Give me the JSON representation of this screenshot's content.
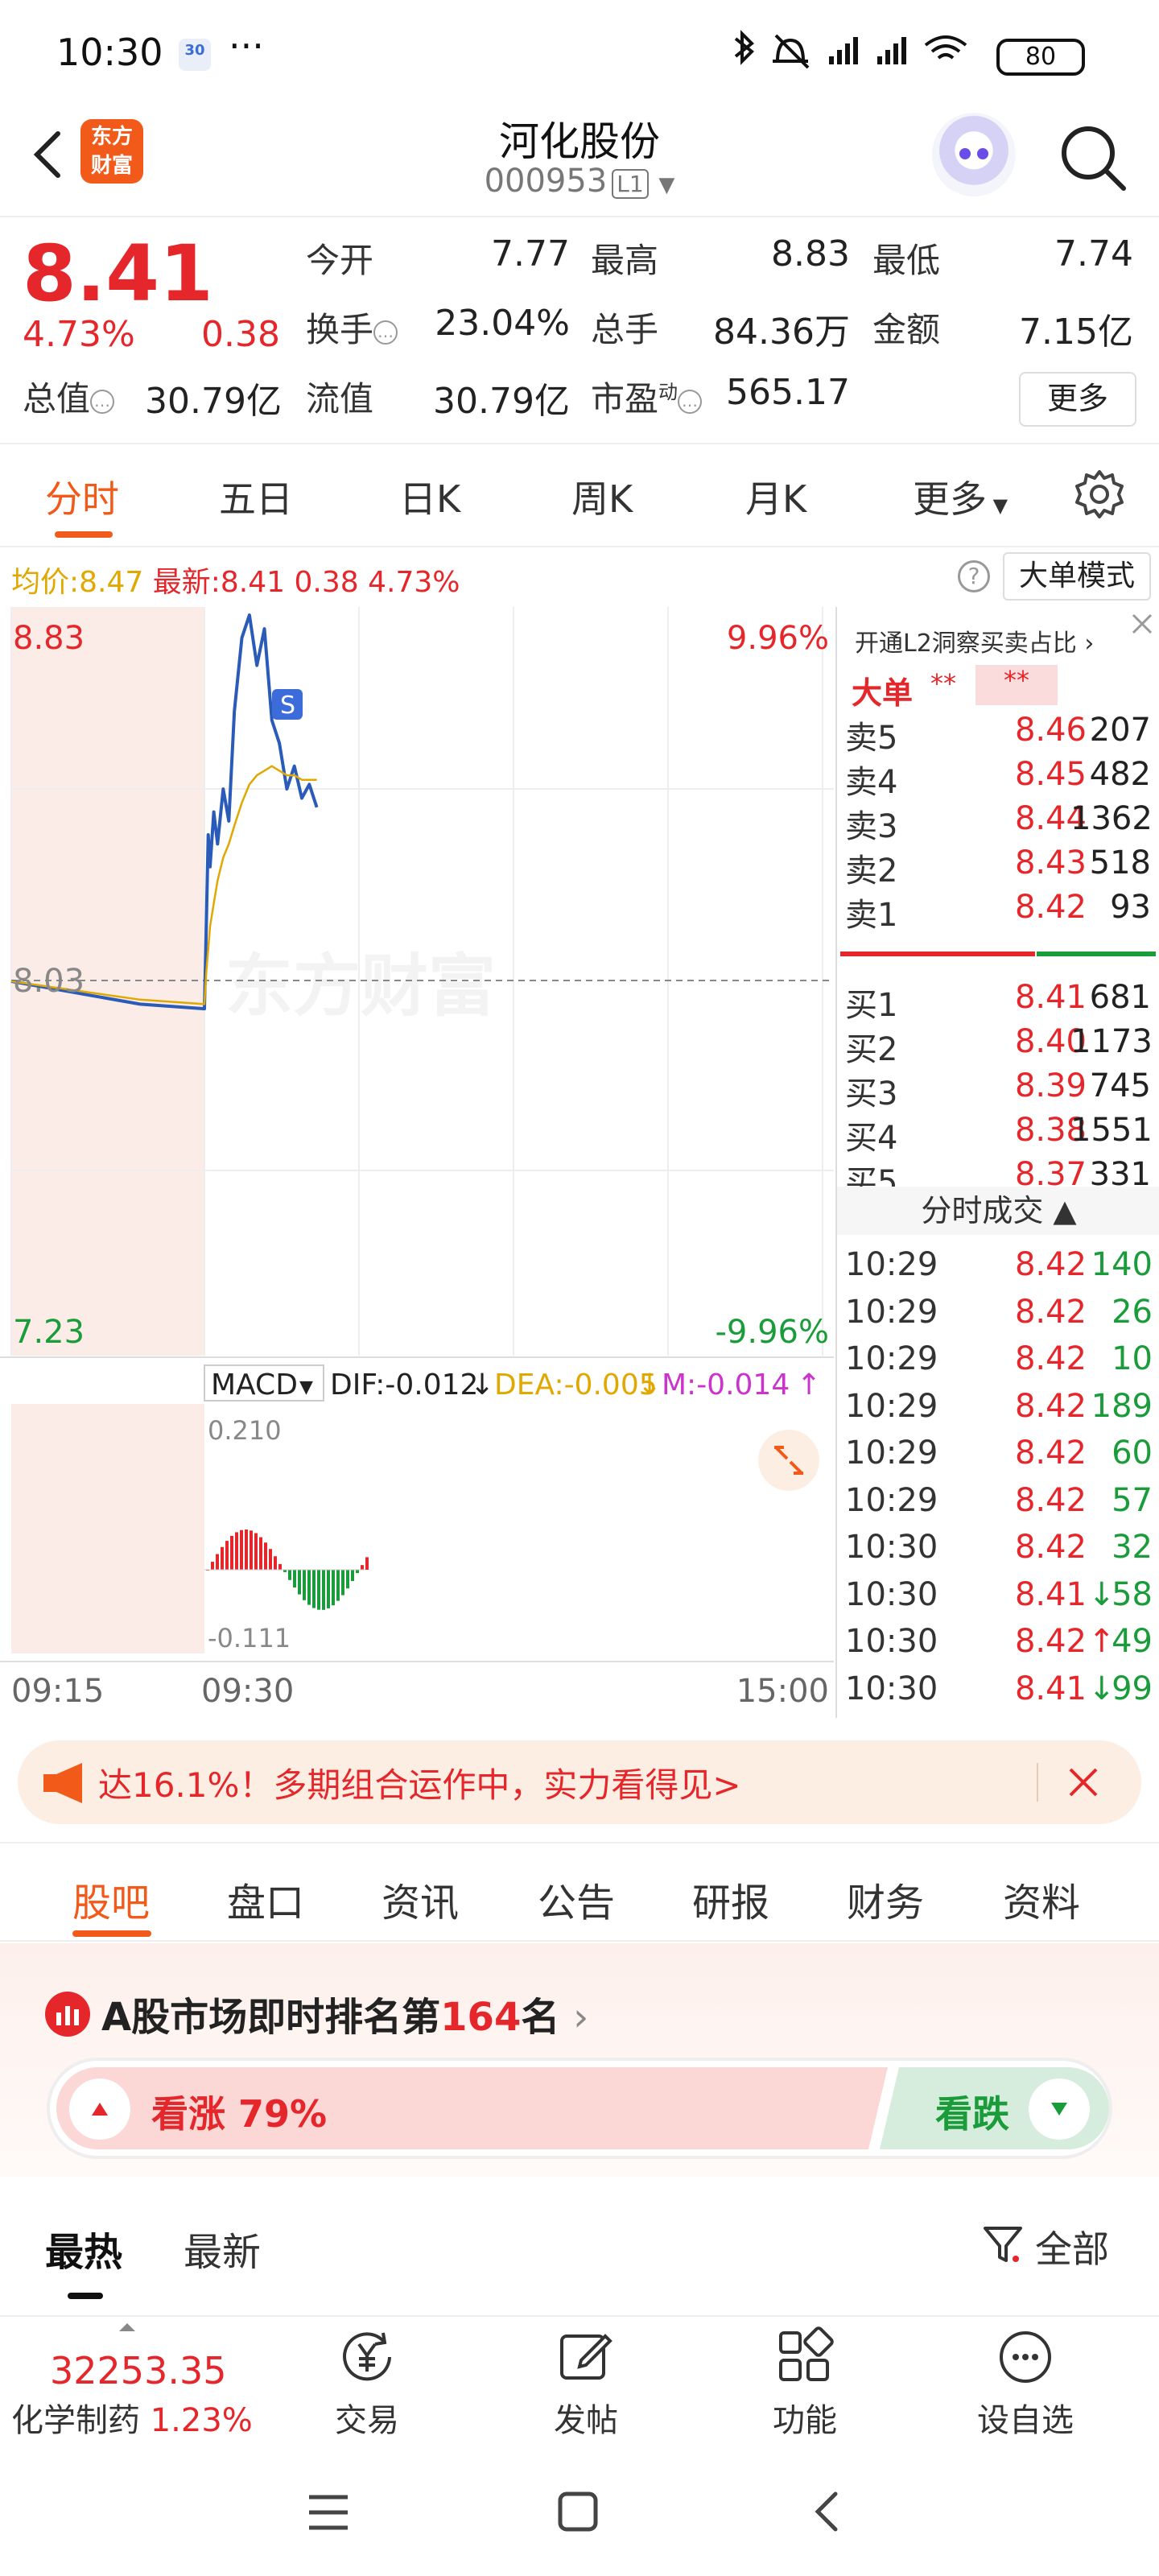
{
  "status_bar": {
    "time": "10:30",
    "indicator": "30",
    "dots": "···",
    "battery": "80",
    "icons": [
      "bluetooth-icon",
      "mute-icon",
      "signal-icon",
      "wifi-icon"
    ]
  },
  "header": {
    "title": "河化股份",
    "code": "000953",
    "level": "L1",
    "logo_line1": "东方",
    "logo_line2": "财富"
  },
  "quote": {
    "price": "8.41",
    "change_pct": "4.73%",
    "change": "0.38",
    "open_label": "今开",
    "open": "7.77",
    "high_label": "最高",
    "high": "8.83",
    "low_label": "最低",
    "low": "7.74",
    "turnover_label": "换手",
    "turnover": "23.04%",
    "volume_label": "总手",
    "volume": "84.36万",
    "amount_label": "金额",
    "amount": "7.15亿",
    "mcap_label": "总值",
    "mcap": "30.79亿",
    "float_label": "流值",
    "float": "30.79亿",
    "pe_label": "市盈",
    "pe_sup": "动",
    "pe": "565.17",
    "more": "更多"
  },
  "period_tabs": [
    "分时",
    "五日",
    "日K",
    "周K",
    "月K",
    "更多"
  ],
  "info_line": {
    "avg_label": "均价:",
    "avg": "8.47",
    "latest_label": "最新:",
    "latest": "8.41",
    "chg": "0.38",
    "pct": "4.73%",
    "mode_button": "大单模式"
  },
  "chart": {
    "price_top": "8.83",
    "price_mid": "8.03",
    "price_bottom": "7.23",
    "pct_top": "9.96%",
    "pct_bottom": "-9.96%",
    "watermark": "东方财富",
    "marker": "S",
    "macd_label": "MACD",
    "dif": "DIF:-0.012",
    "dea": "DEA:-0.005",
    "m": "M:-0.014",
    "macd_top": "0.210",
    "macd_bottom": "-0.111",
    "time_start": "09:15",
    "time_open": "09:30",
    "time_end": "15:00"
  },
  "chart_data": {
    "type": "line",
    "x": [
      "09:15",
      "09:25",
      "09:30",
      "09:31",
      "09:32",
      "09:33",
      "09:35",
      "09:37",
      "09:40",
      "09:43",
      "09:46",
      "09:50",
      "09:54",
      "09:58",
      "10:02",
      "10:06",
      "10:10",
      "10:14",
      "10:18",
      "10:22",
      "10:26",
      "10:30"
    ],
    "series": [
      {
        "values": [
          8.03,
          7.98,
          7.97,
          8.15,
          8.35,
          8.28,
          8.4,
          8.33,
          8.45,
          8.38,
          8.62,
          8.78,
          8.83,
          8.72,
          8.8,
          8.6,
          8.55,
          8.45,
          8.5,
          8.43,
          8.46,
          8.41
        ]
      },
      {
        "values": [
          8.03,
          7.99,
          7.98,
          8.05,
          8.1,
          8.15,
          8.2,
          8.25,
          8.3,
          8.33,
          8.37,
          8.42,
          8.46,
          8.48,
          8.49,
          8.5,
          8.49,
          8.48,
          8.48,
          8.47,
          8.47,
          8.47
        ]
      }
    ],
    "ylim": [
      7.23,
      8.83
    ],
    "grid": true
  },
  "order_book": {
    "l2_text": "开通L2洞察买卖占比",
    "big_label": "大单",
    "big_val1": "**",
    "big_val2": "**",
    "sell": [
      {
        "label": "卖5",
        "price": "8.46",
        "vol": "207"
      },
      {
        "label": "卖4",
        "price": "8.45",
        "vol": "482"
      },
      {
        "label": "卖3",
        "price": "8.44",
        "vol": "1362"
      },
      {
        "label": "卖2",
        "price": "8.43",
        "vol": "518"
      },
      {
        "label": "卖1",
        "price": "8.42",
        "vol": "93"
      }
    ],
    "buy": [
      {
        "label": "买1",
        "price": "8.41",
        "vol": "681"
      },
      {
        "label": "买2",
        "price": "8.40",
        "vol": "1173"
      },
      {
        "label": "买3",
        "price": "8.39",
        "vol": "745"
      },
      {
        "label": "买4",
        "price": "8.38",
        "vol": "1551"
      },
      {
        "label": "买5",
        "price": "8.37",
        "vol": "331"
      }
    ],
    "trades_title": "分时成交",
    "trades": [
      {
        "time": "10:29",
        "price": "8.42",
        "vol": "140",
        "arrow": ""
      },
      {
        "time": "10:29",
        "price": "8.42",
        "vol": "26",
        "arrow": ""
      },
      {
        "time": "10:29",
        "price": "8.42",
        "vol": "10",
        "arrow": ""
      },
      {
        "time": "10:29",
        "price": "8.42",
        "vol": "189",
        "arrow": ""
      },
      {
        "time": "10:29",
        "price": "8.42",
        "vol": "60",
        "arrow": ""
      },
      {
        "time": "10:29",
        "price": "8.42",
        "vol": "57",
        "arrow": ""
      },
      {
        "time": "10:30",
        "price": "8.42",
        "vol": "32",
        "arrow": ""
      },
      {
        "time": "10:30",
        "price": "8.41",
        "vol": "58",
        "arrow": "↓"
      },
      {
        "time": "10:30",
        "price": "8.42",
        "vol": "49",
        "arrow": "↑"
      },
      {
        "time": "10:30",
        "price": "8.41",
        "vol": "99",
        "arrow": "↓"
      }
    ]
  },
  "ad": {
    "text": "达16.1%！多期组合运作中，实力看得见>"
  },
  "content_tabs": [
    "股吧",
    "盘口",
    "资讯",
    "公告",
    "研报",
    "财务",
    "资料"
  ],
  "rank": {
    "prefix": "A股市场即时排名第",
    "num": "164",
    "suffix": "名",
    "up_label": "看涨",
    "up_pct": "79%",
    "up_fraction": 0.79,
    "down_label": "看跌"
  },
  "feed_tabs": [
    "最热",
    "最新"
  ],
  "filter_label": "全部",
  "toolbar": {
    "index_value": "32253.35",
    "index_name": "化学制药",
    "index_pct": "1.23%",
    "items": [
      "交易",
      "发帖",
      "功能",
      "设自选"
    ]
  }
}
